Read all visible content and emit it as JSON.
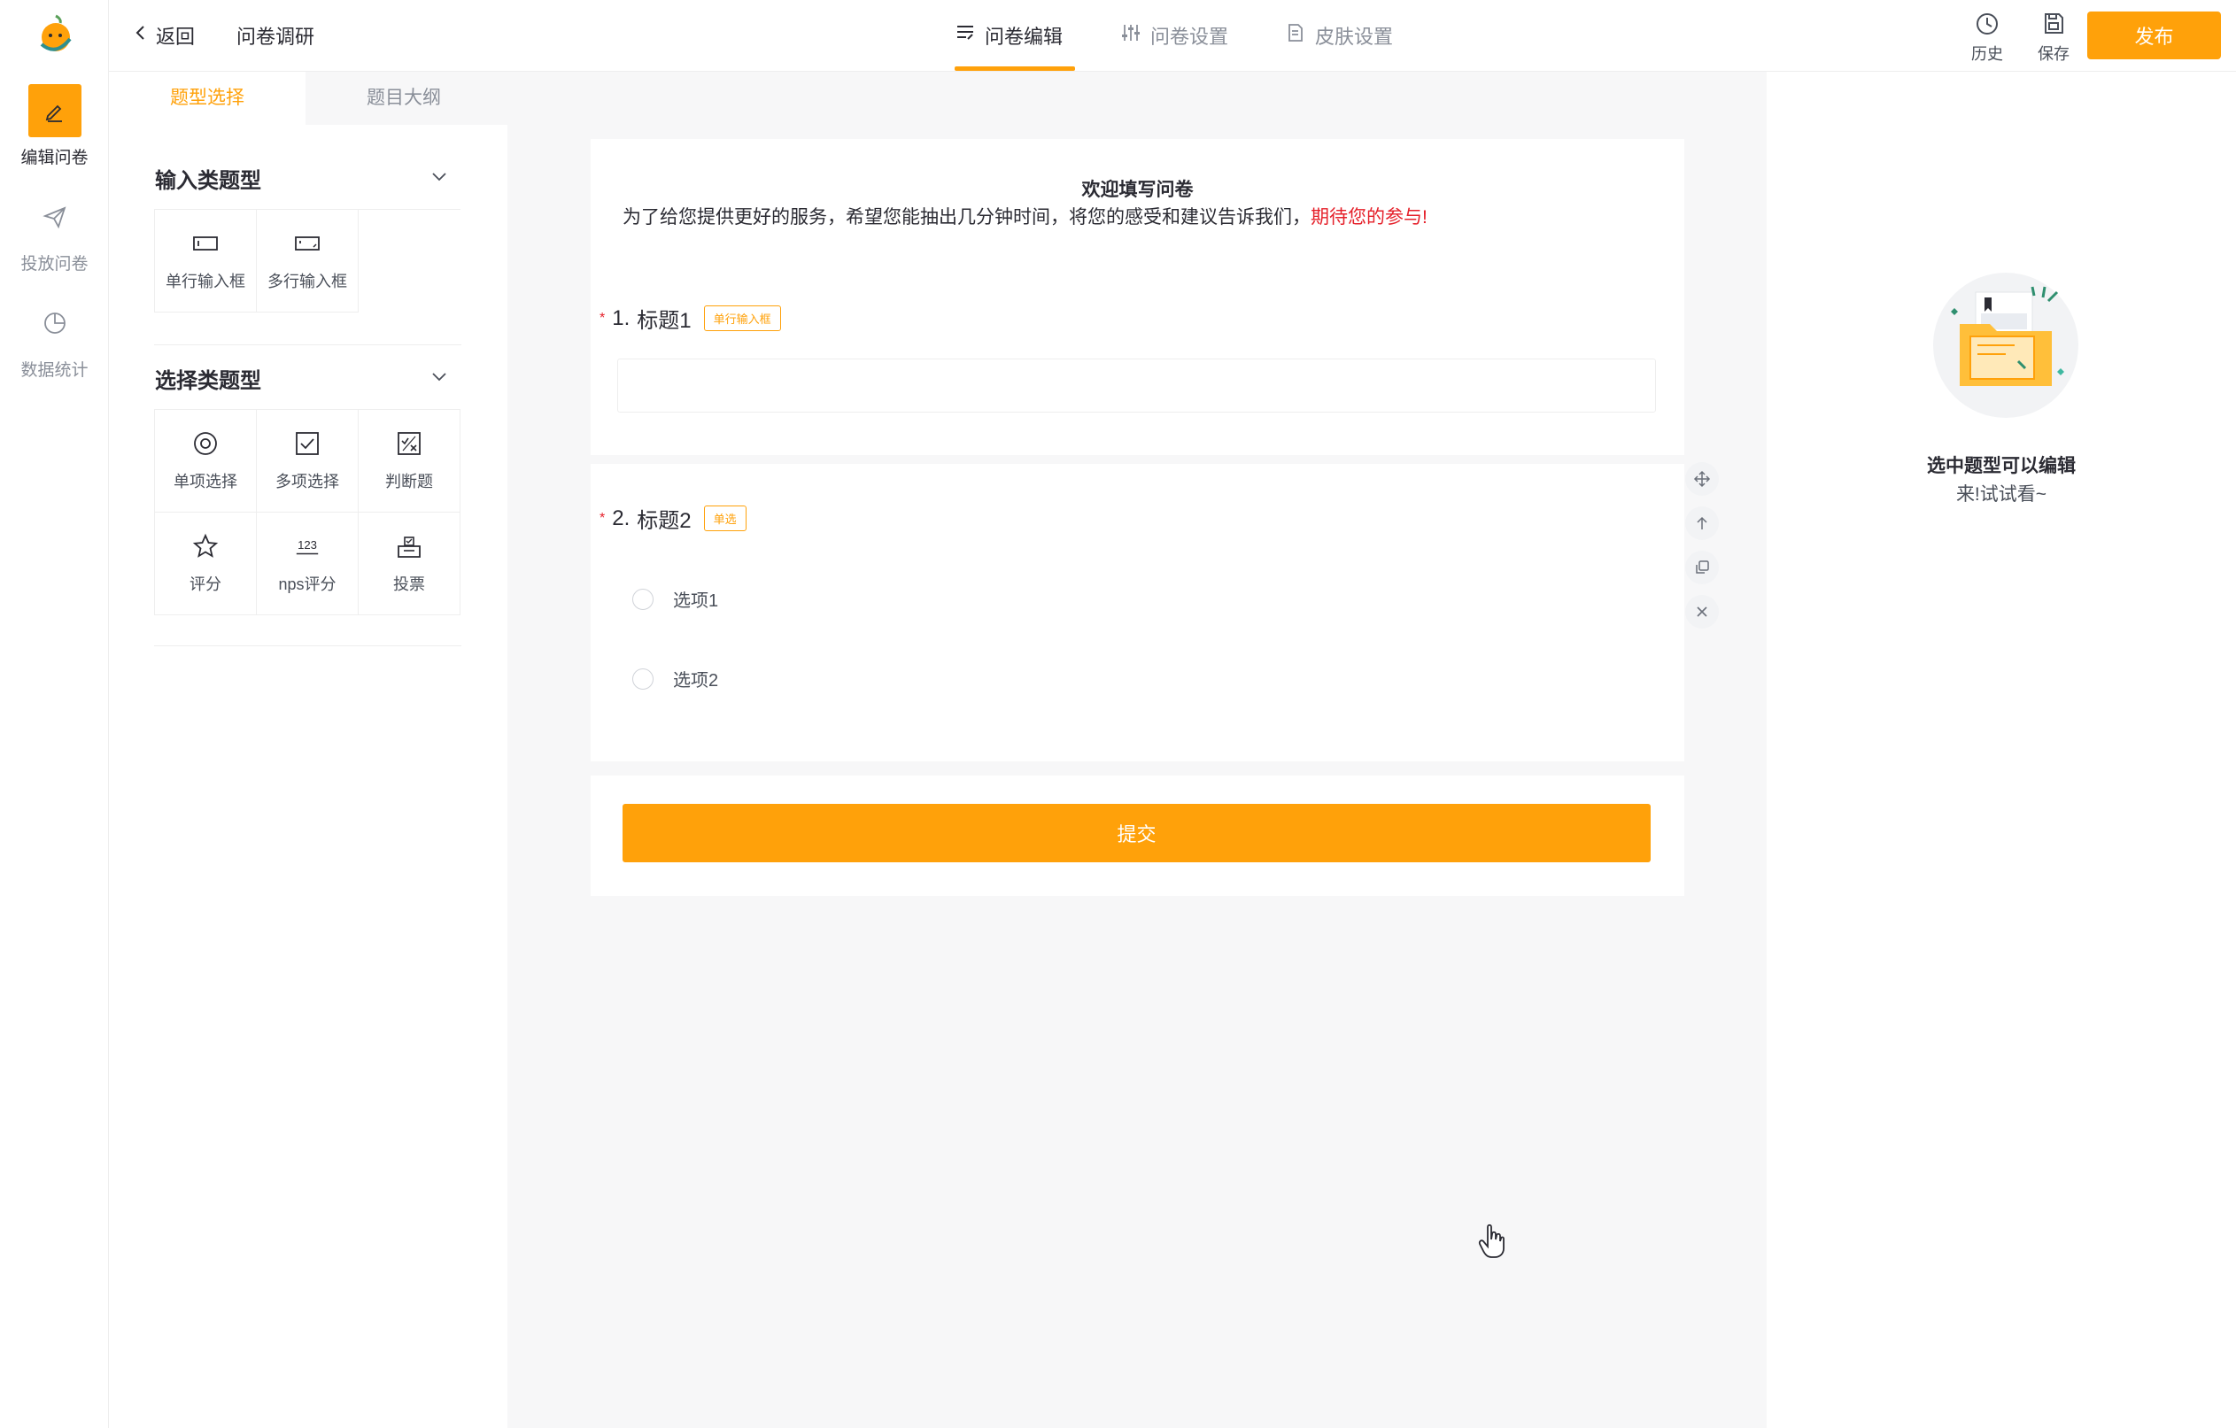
{
  "rail": {
    "items": [
      {
        "label": "编辑问卷",
        "icon": "edit-icon",
        "active": true
      },
      {
        "label": "投放问卷",
        "icon": "send-icon",
        "active": false
      },
      {
        "label": "数据统计",
        "icon": "pie-chart-icon",
        "active": false
      }
    ]
  },
  "header": {
    "back_label": "返回",
    "title": "问卷调研",
    "tabs": [
      {
        "label": "问卷编辑",
        "icon": "list-edit-icon",
        "active": true
      },
      {
        "label": "问卷设置",
        "icon": "sliders-icon",
        "active": false
      },
      {
        "label": "皮肤设置",
        "icon": "doc-settings-icon",
        "active": false
      }
    ],
    "tools": [
      {
        "label": "历史",
        "icon": "clock-icon"
      },
      {
        "label": "保存",
        "icon": "save-icon"
      }
    ],
    "publish_label": "发布"
  },
  "panel": {
    "tabs": [
      {
        "label": "题型选择",
        "active": true
      },
      {
        "label": "题目大纲",
        "active": false
      }
    ],
    "groups": [
      {
        "title": "输入类题型",
        "items": [
          {
            "label": "单行输入框",
            "icon": "single-line-input-icon"
          },
          {
            "label": "多行输入框",
            "icon": "multi-line-input-icon"
          }
        ]
      },
      {
        "title": "选择类题型",
        "items": [
          {
            "label": "单项选择",
            "icon": "radio-icon"
          },
          {
            "label": "多项选择",
            "icon": "checkbox-icon"
          },
          {
            "label": "判断题",
            "icon": "true-false-icon"
          },
          {
            "label": "评分",
            "icon": "star-icon"
          },
          {
            "label": "nps评分",
            "icon": "nps-icon"
          },
          {
            "label": "投票",
            "icon": "vote-icon"
          }
        ]
      }
    ]
  },
  "survey": {
    "title": "欢迎填写问卷",
    "description": "为了给您提供更好的服务，希望您能抽出几分钟时间，将您的感受和建议告诉我们，",
    "description_highlight": "期待您的参与!",
    "questions": [
      {
        "required_mark": "*",
        "number": "1.",
        "title": "标题1",
        "tag": "单行输入框"
      },
      {
        "required_mark": "*",
        "number": "2.",
        "title": "标题2",
        "tag": "单选",
        "options": [
          "选项1",
          "选项2"
        ]
      }
    ],
    "submit_label": "提交"
  },
  "right_panel": {
    "empty_title": "选中题型可以编辑",
    "empty_sub": "来!试试看~"
  },
  "colors": {
    "accent": "#ffa10a",
    "highlight_red": "#e5202a",
    "muted_text": "#8a8f99"
  }
}
